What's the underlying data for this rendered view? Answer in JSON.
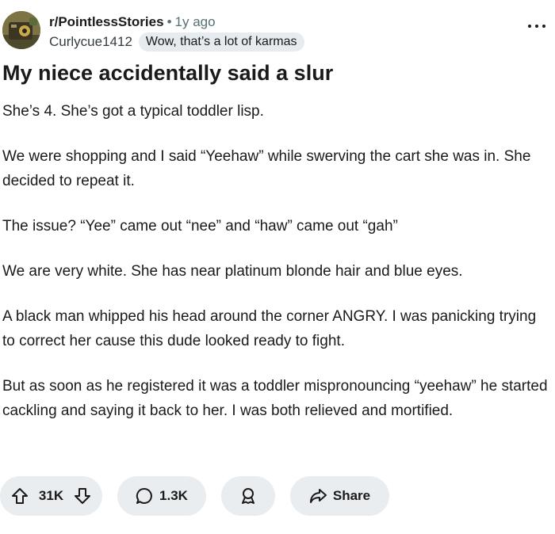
{
  "post": {
    "subreddit": "r/PointlessStories",
    "separator": "•",
    "time_ago": "1y ago",
    "author": "Curlycue1412",
    "flair": "Wow, that’s a lot of karmas",
    "title": "My niece accidentally said a slur",
    "paragraphs": [
      "She’s 4. She’s got a typical toddler lisp.",
      "We were shopping and I said “Yeehaw” while swerving the cart she was in. She decided to repeat it.",
      "The issue? “Yee” came out “nee” and “haw” came out “gah”",
      "We are very white. She has near platinum blonde hair and blue eyes.",
      "A black man whipped his head around the corner ANGRY. I was panicking trying to correct her cause this dude looked ready to fight.",
      "But as soon as he registered it was a toddler mispronouncing “yeehaw” he started cackling and saying it back to her. I was both relieved and mortified."
    ]
  },
  "actions": {
    "upvotes": "31K",
    "comments": "1.3K",
    "share_label": "Share"
  },
  "icons": {
    "more": "more-options-icon",
    "upvote": "upvote-arrow-icon",
    "downvote": "downvote-arrow-icon",
    "comment": "comment-bubble-icon",
    "award": "award-ribbon-icon",
    "share": "share-arrow-icon"
  },
  "colors": {
    "text": "#1a1a1b",
    "meta": "#576f76",
    "pill_bg": "#eaedef",
    "flair_bg": "#e5ebee"
  }
}
